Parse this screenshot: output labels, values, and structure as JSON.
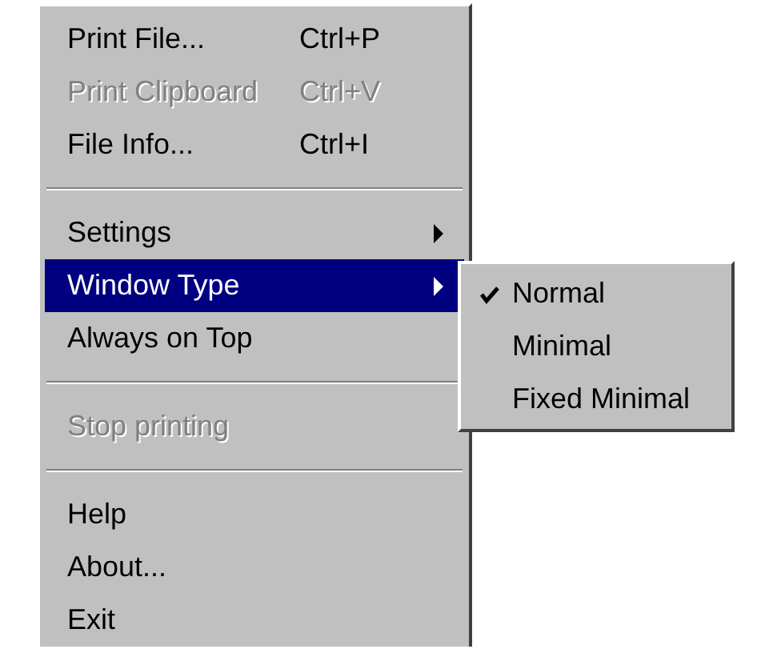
{
  "menu": {
    "items": [
      {
        "kind": "item",
        "label": "Print File...",
        "shortcut": "Ctrl+P",
        "disabled": false,
        "selected": false,
        "has_submenu": false
      },
      {
        "kind": "item",
        "label": "Print Clipboard",
        "shortcut": "Ctrl+V",
        "disabled": true,
        "selected": false,
        "has_submenu": false
      },
      {
        "kind": "item",
        "label": "File Info...",
        "shortcut": "Ctrl+I",
        "disabled": false,
        "selected": false,
        "has_submenu": false
      },
      {
        "kind": "separator"
      },
      {
        "kind": "item",
        "label": "Settings",
        "disabled": false,
        "selected": false,
        "has_submenu": true
      },
      {
        "kind": "item",
        "label": "Window Type",
        "disabled": false,
        "selected": true,
        "has_submenu": true
      },
      {
        "kind": "item",
        "label": "Always on Top",
        "disabled": false,
        "selected": false,
        "has_submenu": false
      },
      {
        "kind": "separator"
      },
      {
        "kind": "item",
        "label": "Stop printing",
        "disabled": true,
        "selected": false,
        "has_submenu": false
      },
      {
        "kind": "separator"
      },
      {
        "kind": "item",
        "label": "Help",
        "disabled": false,
        "selected": false,
        "has_submenu": false
      },
      {
        "kind": "item",
        "label": "About...",
        "disabled": false,
        "selected": false,
        "has_submenu": false
      },
      {
        "kind": "item",
        "label": "Exit",
        "disabled": false,
        "selected": false,
        "has_submenu": false
      }
    ]
  },
  "submenu": {
    "items": [
      {
        "label": "Normal",
        "checked": true
      },
      {
        "label": "Minimal",
        "checked": false
      },
      {
        "label": "Fixed Minimal",
        "checked": false
      }
    ]
  }
}
